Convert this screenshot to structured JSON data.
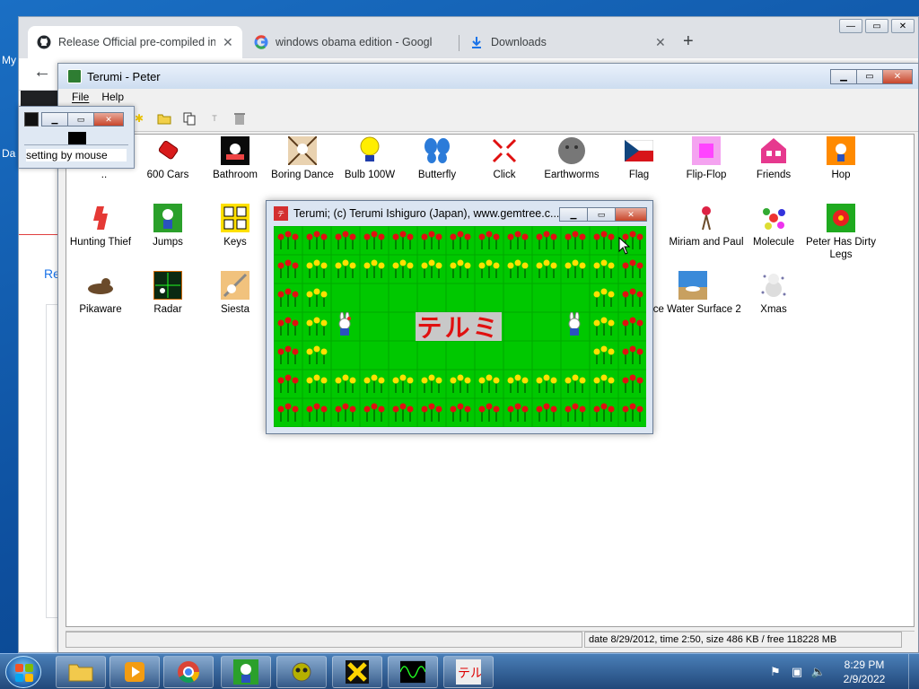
{
  "desktop": {
    "label_1": "My",
    "label_2": "Da"
  },
  "browser": {
    "tabs": [
      {
        "title": "Release Official pre-compiled ins",
        "icon": "github-icon"
      },
      {
        "title": "windows obama edition - Google",
        "icon": "google-icon"
      },
      {
        "title": "Downloads",
        "icon": "download-icon"
      }
    ],
    "page_link": "Re"
  },
  "terumi_main": {
    "title": "Terumi - Peter",
    "menu": {
      "file": "File",
      "help": "Help"
    },
    "items": [
      {
        "label": "..",
        "icon": "folder-up-icon"
      },
      {
        "label": "600 Cars",
        "icon": "cars-icon"
      },
      {
        "label": "Bathroom",
        "icon": "bathroom-icon"
      },
      {
        "label": "Boring Dance",
        "icon": "boring-dance-icon"
      },
      {
        "label": "Bulb 100W",
        "icon": "bulb-icon"
      },
      {
        "label": "Butterfly",
        "icon": "butterfly-icon"
      },
      {
        "label": "Click",
        "icon": "click-icon"
      },
      {
        "label": "Earthworms",
        "icon": "earthworms-icon"
      },
      {
        "label": "Flag",
        "icon": "flag-icon"
      },
      {
        "label": "Flip-Flop",
        "icon": "flip-flop-icon"
      },
      {
        "label": "Friends",
        "icon": "friends-icon"
      },
      {
        "label": "Hop",
        "icon": "hop-icon"
      },
      {
        "label": "Hunting Thief",
        "icon": "hunting-thief-icon"
      },
      {
        "label": "Jumps",
        "icon": "jumps-icon"
      },
      {
        "label": "Keys",
        "icon": "keys-icon"
      },
      {
        "label": "Miriam and Paul",
        "icon": "miriam-paul-icon"
      },
      {
        "label": "Molecule",
        "icon": "molecule-icon"
      },
      {
        "label": "Peter Has Dirty Legs",
        "icon": "peter-icon"
      },
      {
        "label": "Pikaware",
        "icon": "pikaware-icon"
      },
      {
        "label": "Radar",
        "icon": "radar-icon"
      },
      {
        "label": "Siesta",
        "icon": "siesta-icon"
      },
      {
        "label": "face Water Surface 2",
        "icon": "water-surface-icon"
      },
      {
        "label": "Xmas",
        "icon": "xmas-icon"
      }
    ],
    "status_right": "date 8/29/2012, time 2:50, size 486 KB / free 118228 MB"
  },
  "setting_window": {
    "text": "setting by mouse"
  },
  "game_window": {
    "title": "Terumi;   (c) Terumi Ishiguro (Japan), www.gemtree.c...",
    "logo": "テルミ"
  },
  "taskbar": {
    "time": "8:29 PM",
    "date": "2/9/2022",
    "apps": [
      "explorer-icon",
      "media-player-icon",
      "chrome-icon",
      "terumi-peter-icon",
      "alien-icon",
      "yellow-x-icon",
      "oscilloscope-icon",
      "terumi-icon"
    ]
  }
}
